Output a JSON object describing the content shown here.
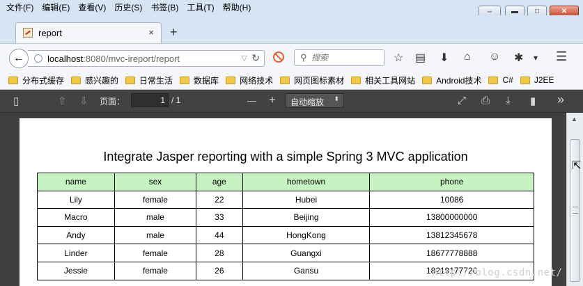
{
  "menu": [
    "文件(F)",
    "编辑(E)",
    "查看(V)",
    "历史(S)",
    "书签(B)",
    "工具(T)",
    "帮助(H)"
  ],
  "window_controls": {
    "restore": "⇔",
    "minimize": "▬",
    "maximize": "□",
    "close": "✕"
  },
  "tab": {
    "title": "report",
    "close": "×",
    "new": "+"
  },
  "nav": {
    "back": "←",
    "url_host": "localhost",
    "url_rest": ":8080/mvc-ireport/report",
    "dropdown": "▽",
    "reload": "↻",
    "search_placeholder": "搜索",
    "icons": {
      "bookmark_star": "☆",
      "reading_list": "▤",
      "download": "⬇",
      "home": "⌂",
      "chat": "☺",
      "addon": "✱",
      "more": "▾",
      "menu": "☰"
    }
  },
  "bookmarks": [
    "分布式缓存",
    "感兴趣的",
    "日常生活",
    "数据库",
    "网络技术",
    "网页图标素材",
    "相关工具网站",
    "Android技术",
    "C#",
    "J2EE"
  ],
  "pdf_toolbar": {
    "sidebar": "▯",
    "prev": "⇧",
    "next": "⇩",
    "page_label": "页面：",
    "page_current": "1",
    "page_total": "/ 1",
    "zoom_out": "—",
    "zoom_in": "+",
    "zoom_value": "自动缩放",
    "zoom_arrow": "⬍",
    "fullscreen": "⤢",
    "print": "⎙",
    "save": "⤓",
    "bookmark": "▮",
    "tools": "»"
  },
  "report": {
    "title": "Integrate Jasper reporting with a simple Spring 3 MVC application",
    "columns": [
      "name",
      "sex",
      "age",
      "hometown",
      "phone"
    ],
    "rows": [
      [
        "Lily",
        "female",
        "22",
        "Hubei",
        "10086"
      ],
      [
        "Macro",
        "male",
        "33",
        "Beijing",
        "13800000000"
      ],
      [
        "Andy",
        "male",
        "44",
        "HongKong",
        "13812345678"
      ],
      [
        "Linder",
        "female",
        "28",
        "Guangxi",
        "18677778888"
      ],
      [
        "Jessie",
        "female",
        "26",
        "Gansu",
        "18219177720"
      ]
    ]
  },
  "watermark": "http://blog.csdn.net/",
  "colors": {
    "header_bg": "#c7f3c3",
    "viewer_bg": "#404040",
    "toolbar_bg": "#424242"
  }
}
